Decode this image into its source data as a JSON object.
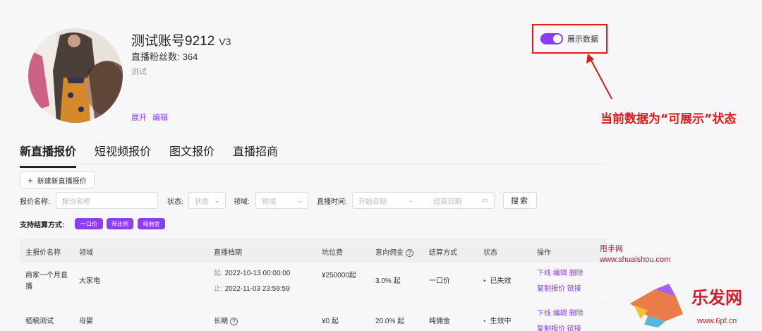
{
  "profile": {
    "name": "测试账号9212",
    "version": "V3",
    "fans_label": "直播粉丝数:",
    "fans_count": "364",
    "description": "测试",
    "expand_link": "展开",
    "edit_link": "编辑"
  },
  "toggle": {
    "label": "展示数据",
    "state": "on"
  },
  "annotation": {
    "text": "当前数据为“可展示”状态"
  },
  "tabs": [
    {
      "label": "新直播报价",
      "active": true
    },
    {
      "label": "短视频报价",
      "active": false
    },
    {
      "label": "图文报价",
      "active": false
    },
    {
      "label": "直播招商",
      "active": false
    }
  ],
  "new_button": {
    "label": "新建新直播报价"
  },
  "filters": {
    "name_label": "报价名称:",
    "name_placeholder": "报价名称",
    "status_label": "状态:",
    "status_placeholder": "状态",
    "domain_label": "领域:",
    "domain_placeholder": "领域",
    "time_label": "直播时间:",
    "start_placeholder": "开始日期",
    "end_placeholder": "结束日期",
    "search_button": "搜索"
  },
  "settlement": {
    "label": "支持结算方式:",
    "chips": [
      "一口价",
      "带比例",
      "纯佣金"
    ]
  },
  "table": {
    "headers": [
      "主报价名称",
      "领域",
      "直播档期",
      "坑位费",
      "意向佣金",
      "结算方式",
      "状态",
      "操作"
    ],
    "rows": [
      {
        "name": "商家一个月直播",
        "domain": "大家电",
        "schedule_start_label": "起:",
        "schedule_start": "2022-10-13 00:00:00",
        "schedule_end_label": "止:",
        "schedule_end": "2022-11-03 23:59:59",
        "fee": "¥250000起",
        "commission": "3.0% 起",
        "settlement": "一口价",
        "status": "已失效",
        "ops": [
          "下线",
          "编辑",
          "删除",
          "复制报价",
          "链接"
        ]
      },
      {
        "name": "嵇稿测试",
        "domain": "母婴",
        "schedule": "长期",
        "fee": "¥0 起",
        "commission": "20.0% 起",
        "settlement": "纯佣金",
        "status": "生效中",
        "ops": [
          "下线",
          "编辑",
          "删除",
          "复制报价",
          "链接"
        ]
      }
    ]
  },
  "watermarks": {
    "site_cn": "甩手网",
    "site_url": "www.shuaishou.com",
    "brand": "乐发网",
    "brand_url": "www.6pf.cn"
  },
  "colors": {
    "accent": "#8a3ef0",
    "annotation": "#e01818"
  }
}
